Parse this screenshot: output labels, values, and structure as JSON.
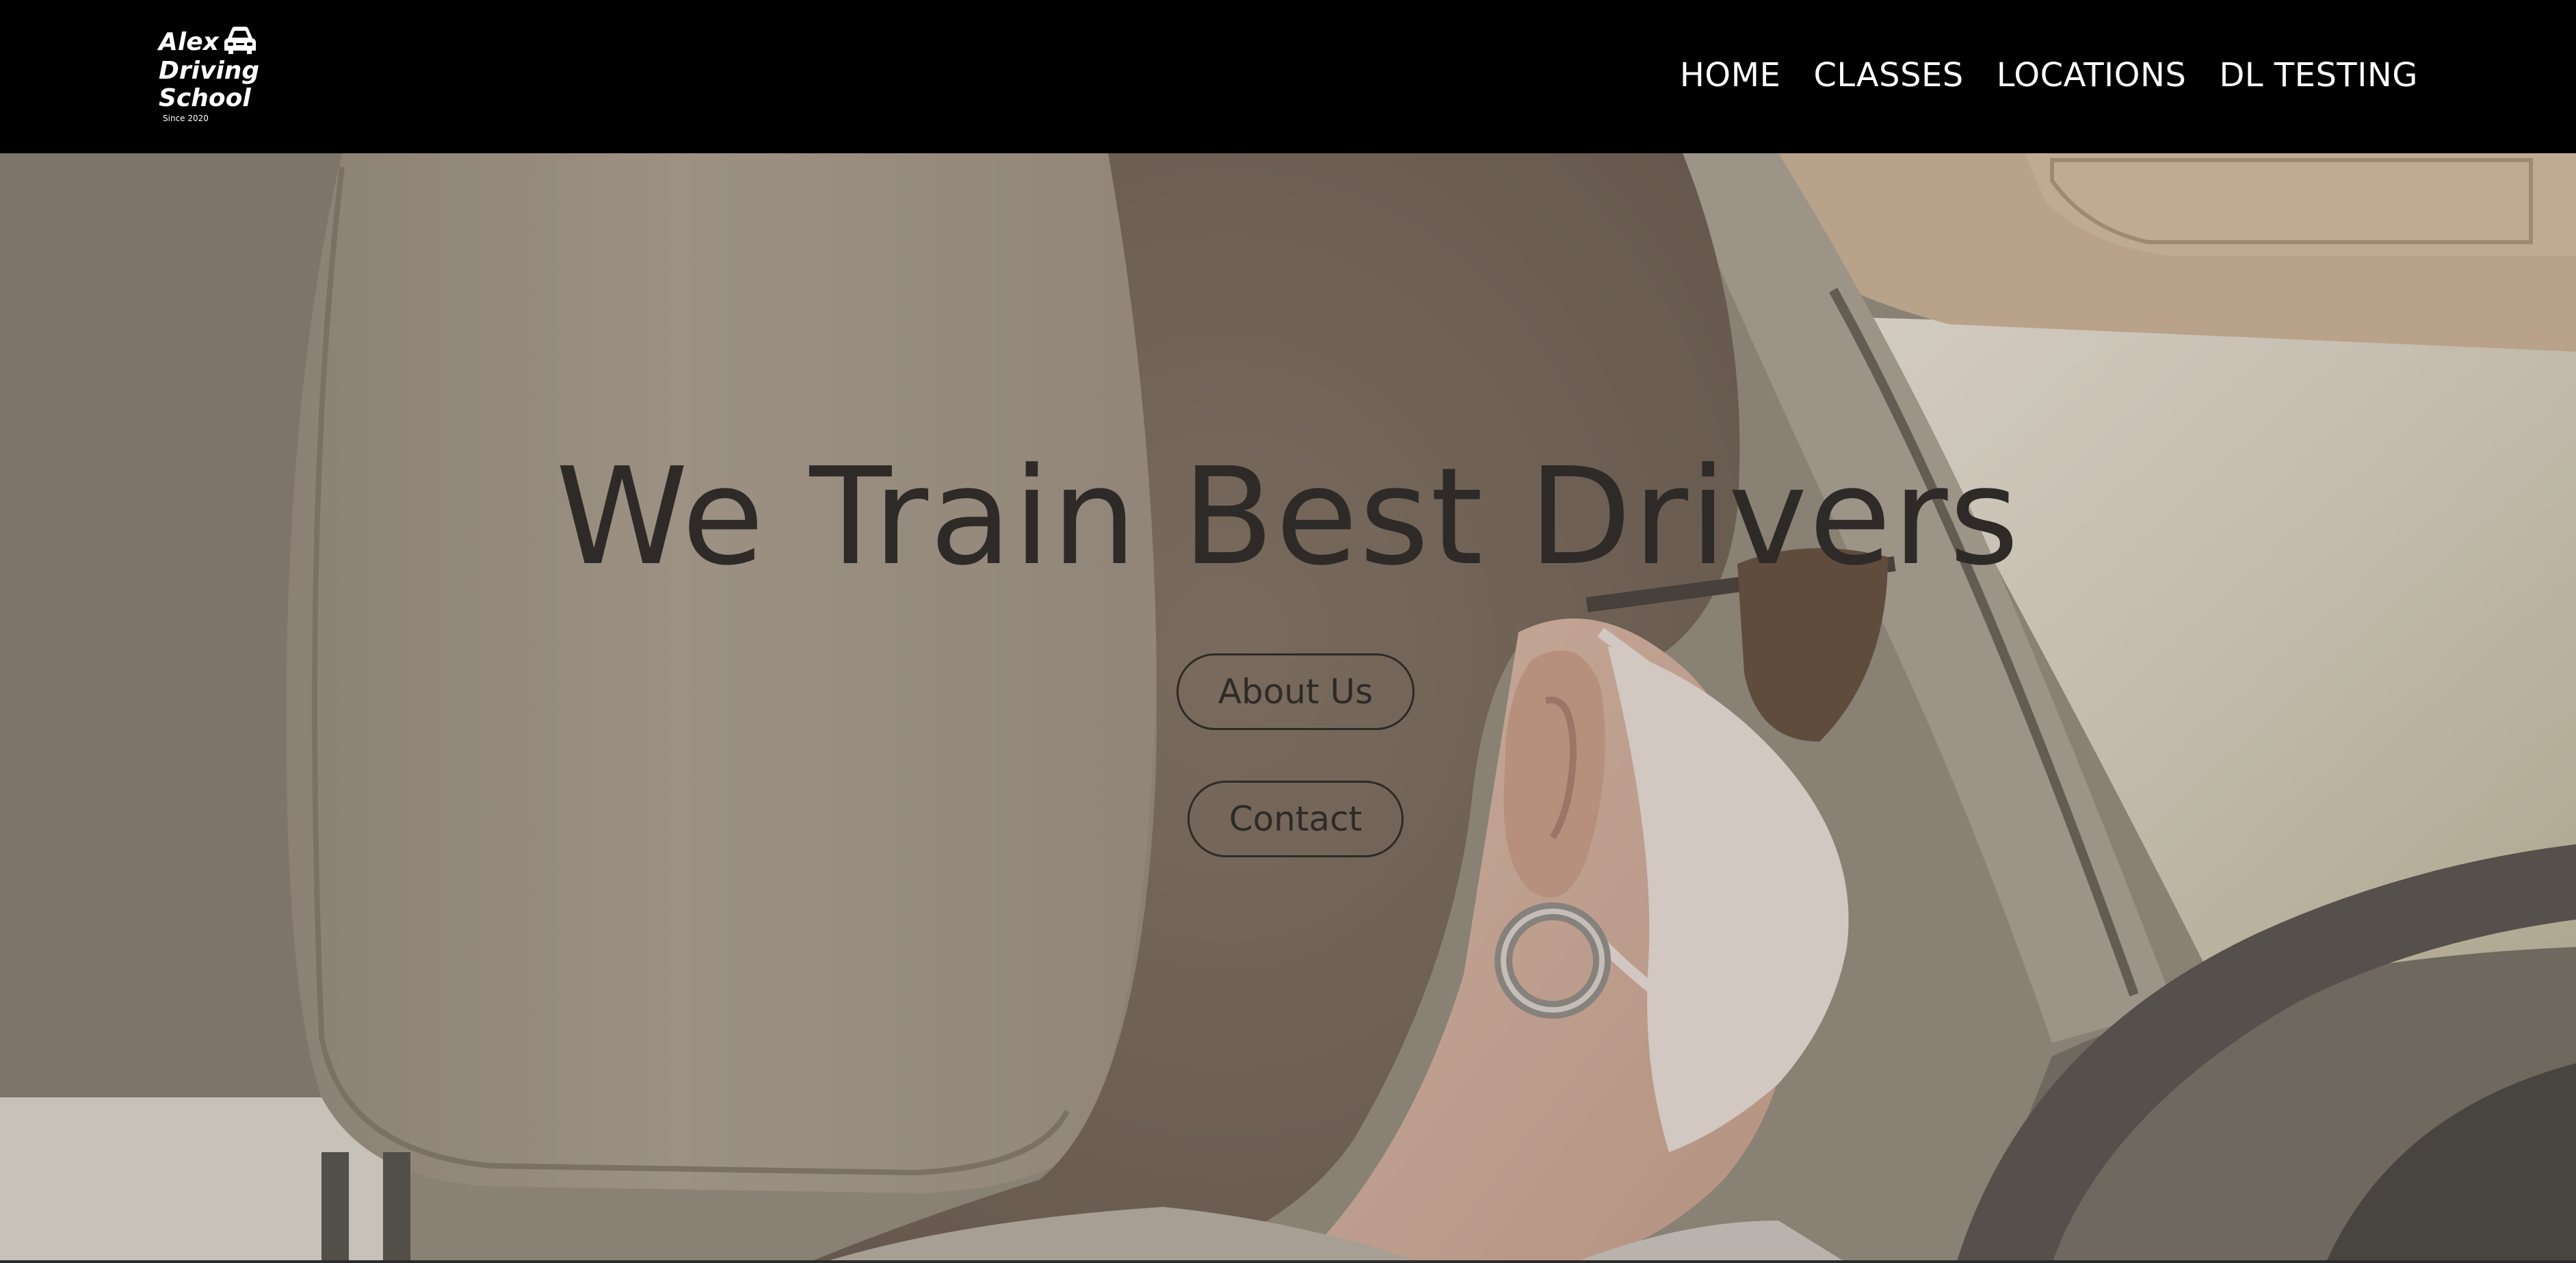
{
  "brand": {
    "line1": "Alex",
    "line2": "Driving",
    "line3": "School",
    "since": "Since 2020",
    "icon": "car-icon"
  },
  "nav": {
    "items": [
      {
        "label": "HOME"
      },
      {
        "label": "CLASSES"
      },
      {
        "label": "LOCATIONS"
      },
      {
        "label": "DL TESTING"
      }
    ]
  },
  "hero": {
    "title": "We Train Best Drivers",
    "about_button": "About Us",
    "contact_button": "Contact",
    "image": "woman-driving-car-photo"
  },
  "colors": {
    "navbar_bg": "#000000",
    "nav_text": "#ffffff",
    "hero_text": "#2e2a27"
  }
}
